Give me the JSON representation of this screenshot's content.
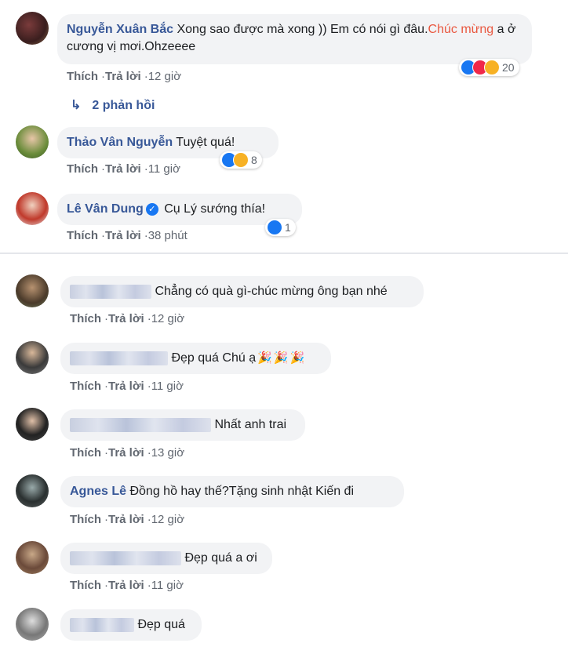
{
  "labels": {
    "like": "Thích",
    "reply": "Trả lời",
    "sep": "·"
  },
  "comments": [
    {
      "author": "Nguyễn Xuân Bắc",
      "text_a": "Xong sao được mà xong )) Em có nói gì đâu.",
      "text_red": "Chúc mừng",
      "text_b": " a ở cương vị mơi.Ohzeeee",
      "time": "12 giờ",
      "reactions": [
        "like-icon",
        "love-icon",
        "haha-icon"
      ],
      "reaction_count": "20"
    },
    {
      "author": "Thảo Vân Nguyễn",
      "text": "Tuyệt quá!",
      "time": "11 giờ",
      "reactions": [
        "like-icon",
        "haha-icon"
      ],
      "reaction_count": "8"
    },
    {
      "author": "Lê Vân Dung",
      "text": "Cụ Lý sướng thía!",
      "time": "38 phút",
      "reactions": [
        "like-icon"
      ],
      "reaction_count": "1"
    },
    {
      "author": "",
      "text": "Chẳng có quà gì-chúc mừng ông bạn nhé",
      "time": "12 giờ"
    },
    {
      "author": "",
      "text": "Đẹp quá Chú ạ",
      "time": "11 giờ"
    },
    {
      "author": "",
      "text": "Nhất anh trai",
      "time": "13 giờ"
    },
    {
      "author": "Agnes Lê",
      "text": "Đồng hồ hay thế?Tặng sinh nhật Kiến đi",
      "time": "12 giờ"
    },
    {
      "author": "",
      "text": "Đẹp quá a ơi",
      "time": "11 giờ"
    },
    {
      "author": "",
      "text": "Đẹp quá",
      "time": ""
    }
  ],
  "replies_label": "2 phản hồi",
  "colors": {
    "name": "#385898",
    "highlight": "#e9573f",
    "bubble": "#f2f3f5",
    "meta": "#616770",
    "like": "#1877f2"
  }
}
